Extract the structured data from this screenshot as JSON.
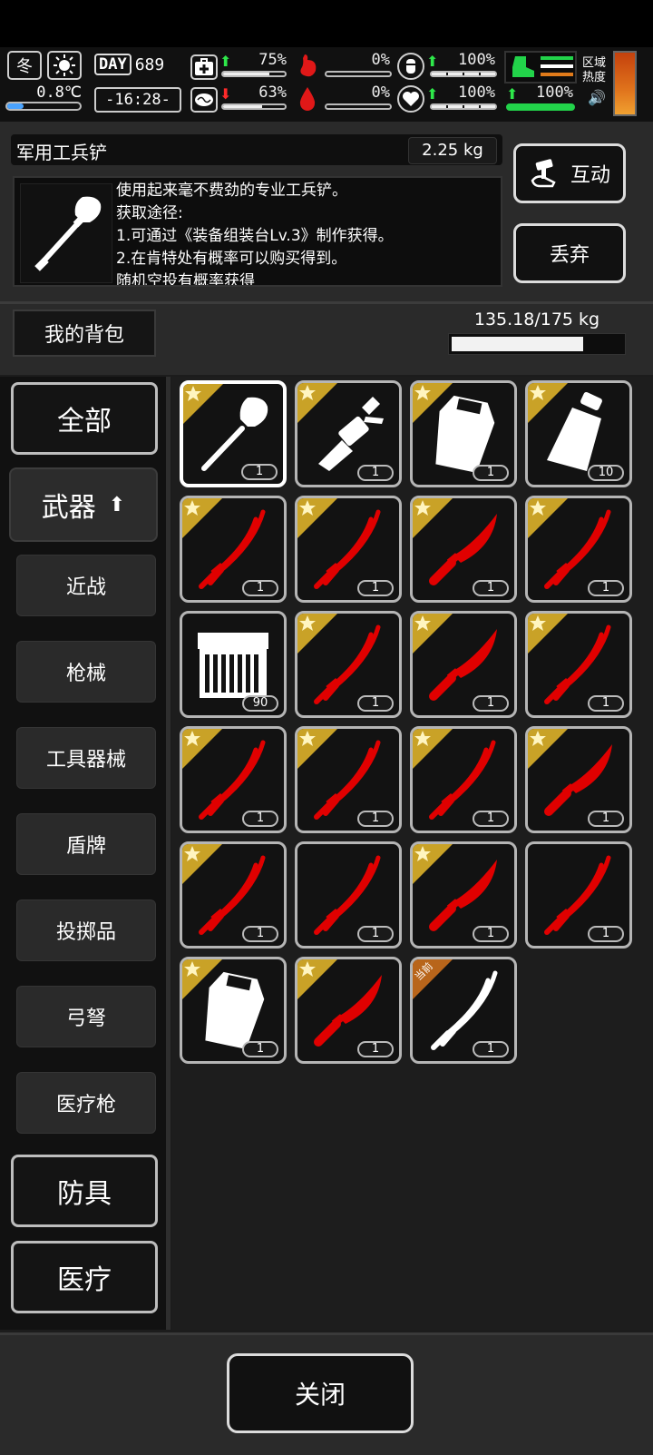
{
  "hud": {
    "season": "冬",
    "temperature": "0.8℃",
    "day_label": "DAY",
    "day": "689",
    "time": "-16:28-",
    "stats_left": [
      {
        "icon": "medkit-icon",
        "arrow": "up",
        "value": "75%",
        "fill": 0.75
      },
      {
        "icon": "brain-icon",
        "arrow": "down",
        "value": "63%",
        "fill": 0.63
      }
    ],
    "stats_mid": [
      {
        "icon": "stomach-icon",
        "value": "0%",
        "fill": 0
      },
      {
        "icon": "blood-drop-icon",
        "value": "0%",
        "fill": 0
      }
    ],
    "stats_right": [
      {
        "icon": "water-icon",
        "arrow": "up",
        "value": "100%",
        "fill": 1
      },
      {
        "icon": "heart-icon",
        "arrow": "up",
        "value": "100%",
        "fill": 1
      }
    ],
    "stamina": {
      "icon": "boot-icon",
      "value": "100%",
      "fill": 1
    },
    "zone": {
      "label_line1": "区域",
      "label_line2": "热度"
    }
  },
  "item": {
    "name": "军用工兵铲",
    "weight": "2.25 kg",
    "description": [
      "使用起来毫不费劲的专业工兵铲。",
      "获取途径:",
      "1.可通过《装备组装台Lv.3》制作获得。",
      "2.在肯特处有概率可以购买得到。",
      "随机空投有概率获得"
    ],
    "interact_label": "互动",
    "discard_label": "丢弃"
  },
  "backpack": {
    "title": "我的背包",
    "weight": "135.18/175 kg",
    "fill": 0.772
  },
  "categories": {
    "all": "全部",
    "weapons": "武器",
    "melee": "近战",
    "firearms": "枪械",
    "tools": "工具器械",
    "shields": "盾牌",
    "throwables": "投掷品",
    "bows": "弓弩",
    "medgun": "医疗枪",
    "armor": "防具",
    "medical": "医疗"
  },
  "items": [
    {
      "type": "shovel",
      "count": "1",
      "star": true,
      "selected": true
    },
    {
      "type": "multitool",
      "count": "1",
      "star": true
    },
    {
      "type": "vest",
      "count": "1",
      "star": true
    },
    {
      "type": "flask",
      "count": "10",
      "star": true
    },
    {
      "type": "katana",
      "count": "1",
      "star": true
    },
    {
      "type": "katana",
      "count": "1",
      "star": true
    },
    {
      "type": "knife",
      "count": "1",
      "star": true
    },
    {
      "type": "katana",
      "count": "1",
      "star": true
    },
    {
      "type": "ammo",
      "count": "90",
      "star": false
    },
    {
      "type": "katana",
      "count": "1",
      "star": true
    },
    {
      "type": "knife",
      "count": "1",
      "star": true
    },
    {
      "type": "katana",
      "count": "1",
      "star": true
    },
    {
      "type": "katana",
      "count": "1",
      "star": true
    },
    {
      "type": "katana",
      "count": "1",
      "star": true
    },
    {
      "type": "katana",
      "count": "1",
      "star": true
    },
    {
      "type": "knife",
      "count": "1",
      "star": true
    },
    {
      "type": "katana",
      "count": "1",
      "star": true
    },
    {
      "type": "katana",
      "count": "1",
      "star": false
    },
    {
      "type": "knife",
      "count": "1",
      "star": true
    },
    {
      "type": "katana",
      "count": "1",
      "star": false
    },
    {
      "type": "vest",
      "count": "1",
      "star": true
    },
    {
      "type": "knife",
      "count": "1",
      "star": true
    },
    {
      "type": "katana-white",
      "count": "1",
      "star": false,
      "badge": "当前"
    }
  ],
  "footer": {
    "close_label": "关闭"
  },
  "colors": {
    "red_weapon": "#e00000",
    "gold_badge": "#c9a227",
    "current_badge": "#b8651b"
  }
}
